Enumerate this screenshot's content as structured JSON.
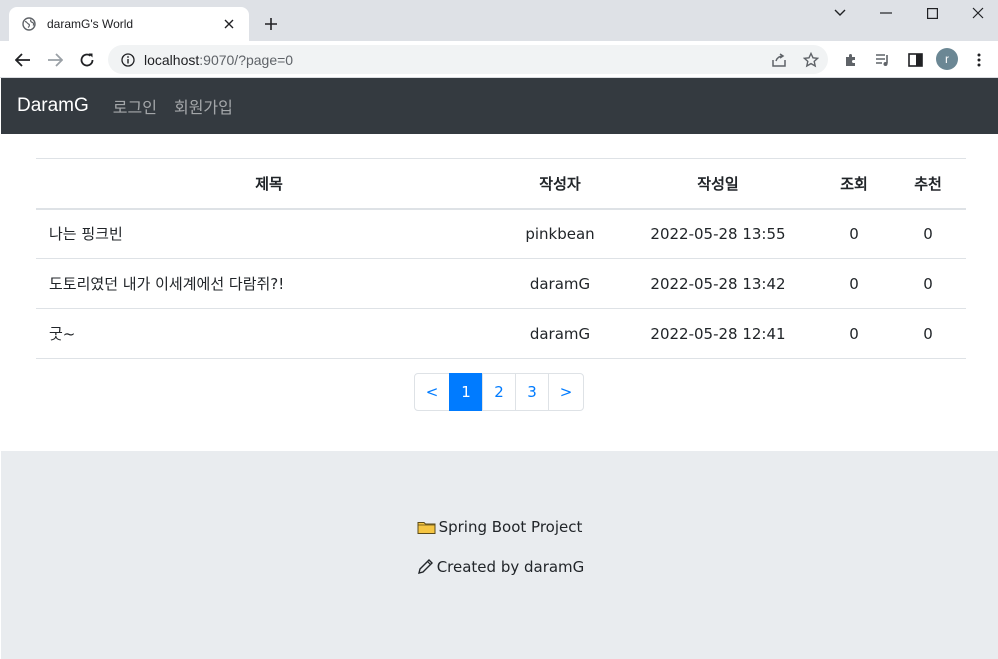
{
  "browser": {
    "tab_title": "daramG's World",
    "url_host": "localhost",
    "url_rest": ":9070/?page=0",
    "avatar_letter": "r"
  },
  "navbar": {
    "brand": "DaramG",
    "links": [
      "로그인",
      "회원가입"
    ],
    "bg_color": "#343a40"
  },
  "board": {
    "headers": [
      "제목",
      "작성자",
      "작성일",
      "조회",
      "추천"
    ],
    "rows": [
      {
        "title": "나는 핑크빈",
        "author": "pinkbean",
        "date": "2022-05-28 13:55",
        "views": "0",
        "likes": "0"
      },
      {
        "title": "도토리였던 내가 이세계에선 다람쥐?!",
        "author": "daramG",
        "date": "2022-05-28 13:42",
        "views": "0",
        "likes": "0"
      },
      {
        "title": "굿~",
        "author": "daramG",
        "date": "2022-05-28 12:41",
        "views": "0",
        "likes": "0"
      }
    ]
  },
  "pagination": {
    "prev": "<",
    "pages": [
      "1",
      "2",
      "3"
    ],
    "active_page": "1",
    "next": ">",
    "accent_color": "#007bff"
  },
  "footer": {
    "project": "Spring Boot Project",
    "created_by": "Created by daramG",
    "project_icon": "folder-icon",
    "created_icon": "pencil-icon"
  }
}
